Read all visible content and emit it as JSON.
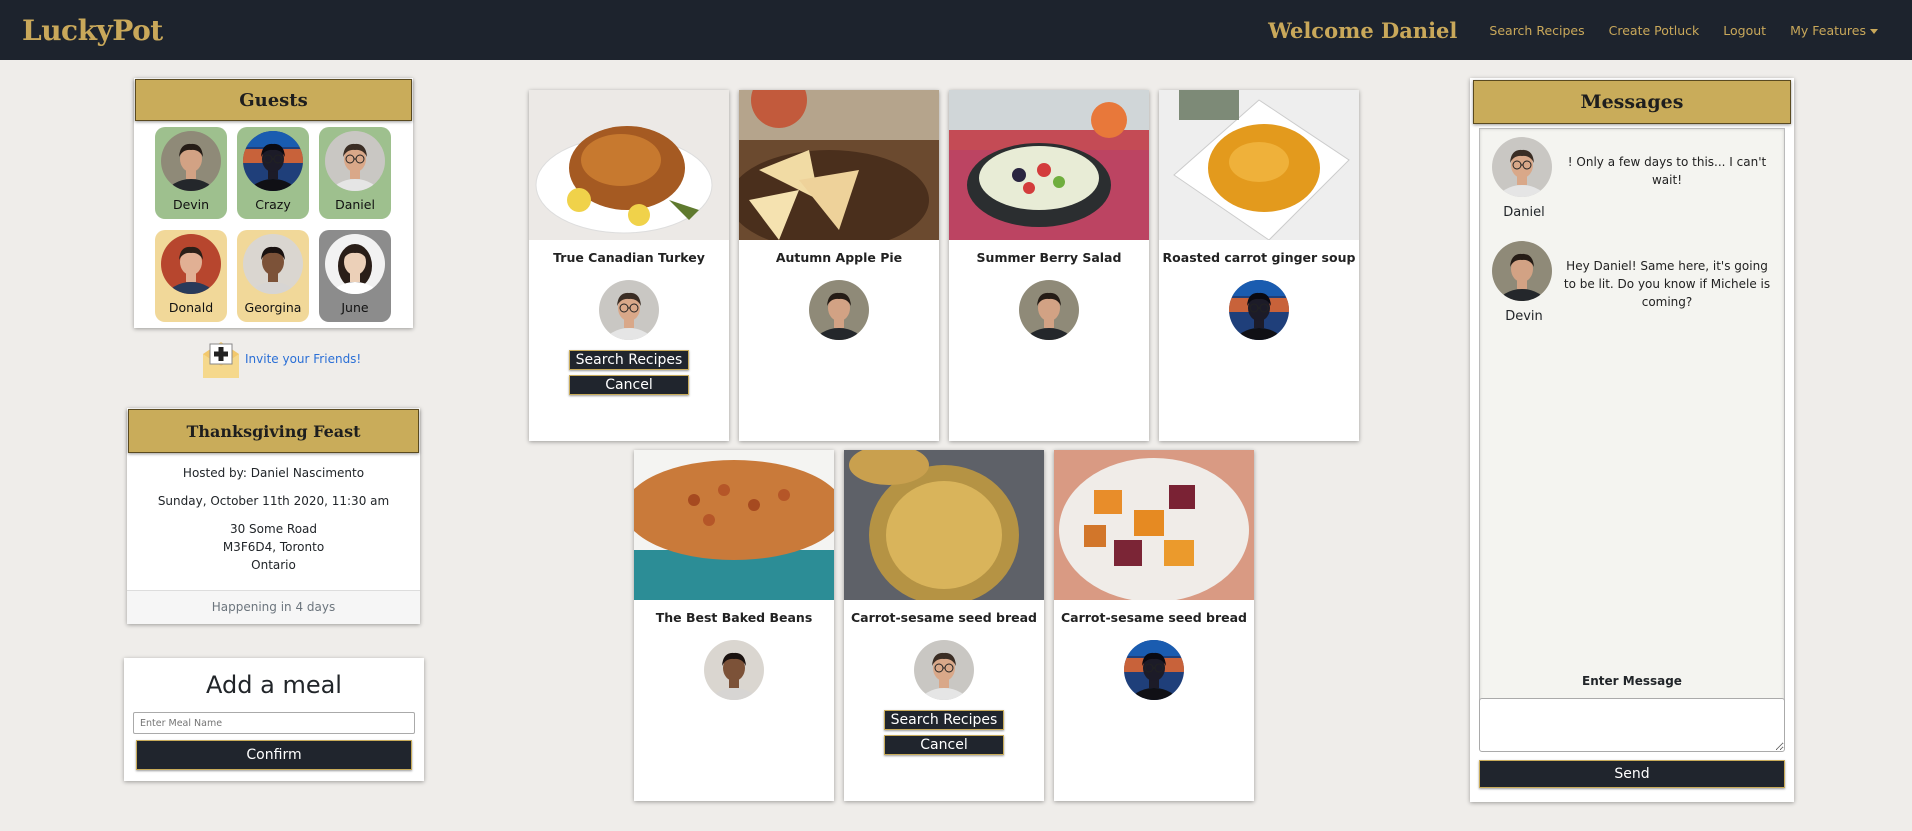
{
  "nav": {
    "brand": "LuckyPot",
    "welcome": "Welcome Daniel",
    "links": [
      "Search Recipes",
      "Create Potluck",
      "Logout",
      "My Features"
    ]
  },
  "guests": {
    "title": "Guests",
    "list": [
      {
        "name": "Devin",
        "status": "accepted"
      },
      {
        "name": "Crazy",
        "status": "accepted"
      },
      {
        "name": "Daniel",
        "status": "accepted"
      },
      {
        "name": "Donald",
        "status": "pending"
      },
      {
        "name": "Georgina",
        "status": "pending"
      },
      {
        "name": "June",
        "status": "declined"
      }
    ],
    "invite_label": "Invite your Friends!"
  },
  "event": {
    "title": "Thanksgiving Feast",
    "host": "Hosted by: Daniel Nascimento",
    "date": "Sunday, October 11th 2020, 11:30 am",
    "address1": "30 Some Road",
    "address2": "M3F6D4, Toronto",
    "address3": "Ontario",
    "footer": "Happening in 4 days"
  },
  "add_meal": {
    "title": "Add a meal",
    "placeholder": "Enter Meal Name",
    "confirm": "Confirm"
  },
  "meals": [
    {
      "name": "True Canadian Turkey",
      "guest": "Daniel",
      "buttons": true
    },
    {
      "name": "Autumn Apple Pie",
      "guest": "Devin",
      "buttons": false
    },
    {
      "name": "Summer Berry Salad",
      "guest": "Devin",
      "buttons": false
    },
    {
      "name": "Roasted carrot ginger soup",
      "guest": "Crazy",
      "buttons": false
    },
    {
      "name": "The Best Baked Beans",
      "guest": "Georgina",
      "buttons": false
    },
    {
      "name": "Carrot-sesame seed bread",
      "guest": "Daniel",
      "buttons": true
    },
    {
      "name": "Carrot-sesame seed bread",
      "guest": "Crazy",
      "buttons": false
    }
  ],
  "meal_buttons": {
    "search": "Search Recipes",
    "cancel": "Cancel"
  },
  "messages": {
    "title": "Messages",
    "items": [
      {
        "author": "Daniel",
        "text": "! Only a few days to this... I can't wait!"
      },
      {
        "author": "Devin",
        "text": "Hey Daniel! Same here, it's going to be lit. Do you know if Michele is coming?"
      }
    ],
    "input_label": "Enter Message",
    "send": "Send"
  },
  "colors": {
    "nav_bg": "#1d232d",
    "gold": "#c9ac5a",
    "accepted": "#9ec08e",
    "pending": "#f1d899",
    "declined": "#8c8c8c",
    "link": "#2a6fd6"
  }
}
